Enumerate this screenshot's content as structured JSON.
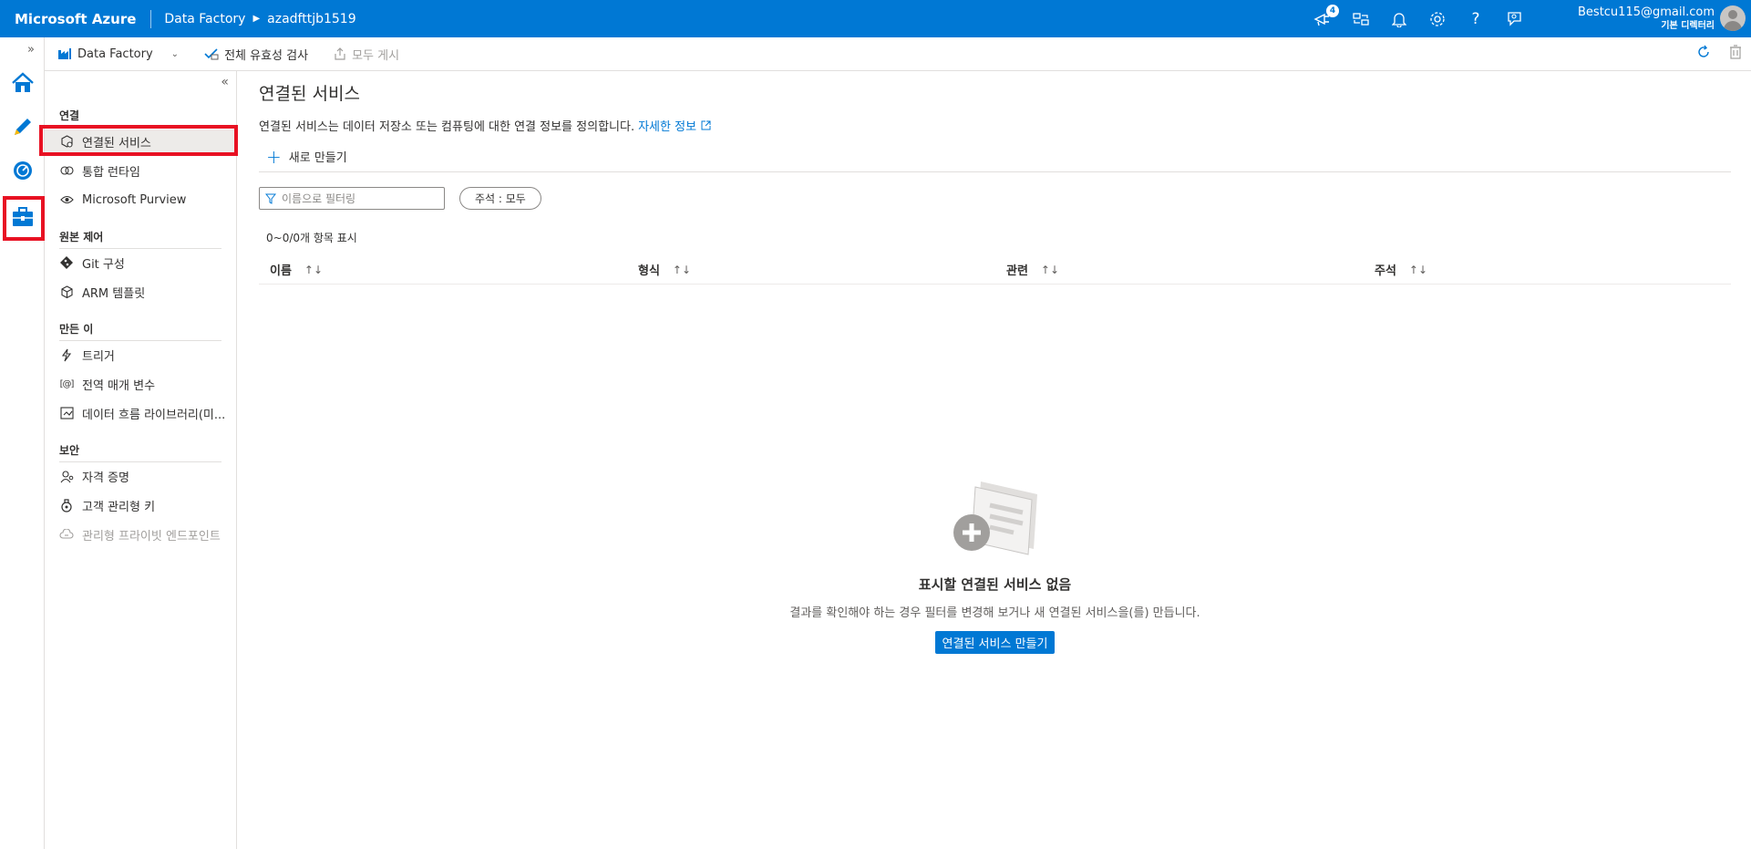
{
  "topbar": {
    "brand": "Microsoft Azure",
    "breadcrumb": [
      "Data Factory",
      "azadfttjb1519"
    ],
    "notification_count": "4",
    "user_email": "Bestcu115@gmail.com",
    "user_role": "기본 디렉터리",
    "accent": "#0078d4"
  },
  "commandbar": {
    "factory_label": "Data Factory",
    "validate_all": "전체 유효성 검사",
    "publish_all": "모두 게시"
  },
  "sidenav": {
    "sections": [
      {
        "label": "연결",
        "items": [
          {
            "label": "연결된 서비스",
            "icon": "linked-service-icon"
          },
          {
            "label": "통합 런타임",
            "icon": "integration-runtime-icon"
          },
          {
            "label": "Microsoft Purview",
            "icon": "purview-eye-icon"
          }
        ]
      },
      {
        "label": "원본 제어",
        "items": [
          {
            "label": "Git 구성",
            "icon": "git-icon"
          },
          {
            "label": "ARM 템플릿",
            "icon": "arm-template-icon"
          }
        ]
      },
      {
        "label": "만든 이",
        "items": [
          {
            "label": "트리거",
            "icon": "trigger-icon"
          },
          {
            "label": "전역 매개 변수",
            "icon": "global-parameter-icon"
          },
          {
            "label": "데이터 흐름 라이브러리(미...",
            "icon": "dataflow-library-icon"
          }
        ]
      },
      {
        "label": "보안",
        "items": [
          {
            "label": "자격 증명",
            "icon": "credential-icon"
          },
          {
            "label": "고객 관리형 키",
            "icon": "customer-key-icon"
          },
          {
            "label": "관리형 프라이빗 엔드포인트",
            "icon": "private-endpoint-icon"
          }
        ]
      }
    ]
  },
  "main": {
    "title": "연결된 서비스",
    "description": "연결된 서비스는 데이터 저장소 또는 컴퓨팅에 대한 연결 정보를 정의합니다.",
    "learn_more": "자세한 정보",
    "new_button": "새로 만들기",
    "filter_placeholder": "이름으로 필터링",
    "annotation_filter": "주석 : 모두",
    "count_text": "0~0/0개 항목 표시",
    "columns": [
      "이름",
      "형식",
      "관련",
      "주석"
    ],
    "empty_title": "표시할 연결된 서비스 없음",
    "empty_subtitle": "결과를 확인해야 하는 경우 필터를 변경해 보거나 새 연결된 서비스을(를) 만듭니다.",
    "empty_button": "연결된 서비스 만들기"
  }
}
